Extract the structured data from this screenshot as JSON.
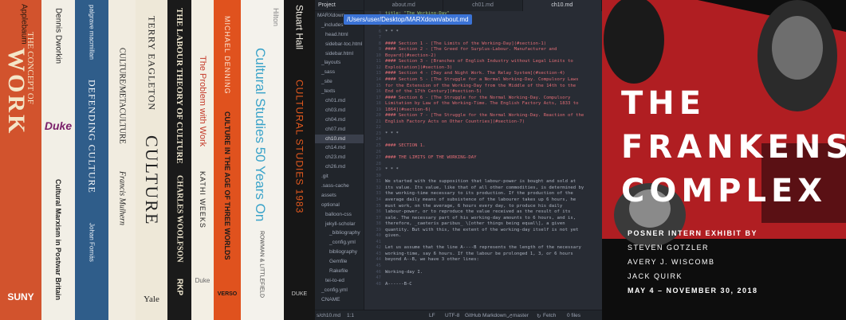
{
  "shelf": {
    "books": [
      {
        "title": "THE CONCEPT OF",
        "big": "WORK",
        "author": "Applebaum",
        "publisher": "SUNY"
      },
      {
        "author": "Dennis Dworkin",
        "publisher": "Duke",
        "title": "Cultural Marxism in Postwar Britain"
      },
      {
        "publisher": "palgrave macmillan",
        "title": "DEFENDING CULTURE",
        "author": "Johan Fornäs"
      },
      {
        "title": "CULTURE/METACULTURE",
        "author": "Francis Mulhern"
      },
      {
        "author": "TERRY EAGLETON",
        "title": "CULTURE",
        "publisher": "Yale"
      },
      {
        "title": "THE LABOUR THEORY OF CULTURE",
        "author": "CHARLES WOOLFSON",
        "publisher": "RKP"
      },
      {
        "title": "The Problem with Work",
        "author": "KATHI WEEKS",
        "publisher": "Duke"
      },
      {
        "author": "MICHAEL DENNING",
        "title": "CULTURE IN THE AGE OF THREE WORLDS",
        "publisher": "VERSO"
      },
      {
        "author": "Hilton",
        "title": "Cultural Studies 50 Years On",
        "publisher": "ROWMAN & LITTLEFIELD"
      },
      {
        "author": "Stuart Hall",
        "title": "CULTURAL STUDIES 1983",
        "publisher": "DUKE"
      }
    ]
  },
  "editor": {
    "tree_header": "Project",
    "path_tooltip": "/Users/user/Desktop/MARXdown/about.md",
    "tree": [
      "MARXdown",
      "_includes",
      "head.html",
      "sidebar-toc.html",
      "sidebar.html",
      "_layouts",
      "_sass",
      "_site",
      "_texts",
      "ch01.md",
      "ch03.md",
      "ch04.md",
      "ch07.md",
      "ch10.md",
      "ch14.md",
      "ch23.md",
      "ch26.md",
      ".git",
      ".sass-cache",
      "assets",
      "optional",
      "balloon-css",
      "jekyll-scholar",
      "_bibliography",
      "_config.yml",
      "bibliography",
      "Gemfile",
      "Rakefile",
      "tei-to-ed",
      "_config.yml",
      "CNAME"
    ],
    "selected_file": "ch10.md",
    "tabs": [
      "about.md",
      "ch01.md",
      "ch10.md"
    ],
    "active_tab": "ch10.md",
    "code": [
      {
        "c": "c-str",
        "t": "title: \"The Working-Day\""
      },
      {
        "c": "c-text",
        "t": "author:"
      },
      {
        "c": "c-text",
        "t": ""
      },
      {
        "c": "c-text",
        "t": "* * *"
      },
      {
        "c": "c-text",
        "t": ""
      },
      {
        "c": "c-head",
        "t": "#### Section 1 - [The Limits of the Working-Day](#section-1)"
      },
      {
        "c": "c-head",
        "t": "#### Section 2 - [The Greed for Surplus-Labour. Manufacturer and"
      },
      {
        "c": "c-head",
        "t": "Boyard](#section-2)"
      },
      {
        "c": "c-head",
        "t": "#### Section 3 - [Branches of English Industry without Legal Limits to"
      },
      {
        "c": "c-head",
        "t": "Exploitation](#section-3)"
      },
      {
        "c": "c-head",
        "t": "#### Section 4 - [Day and Night Work. The Relay System](#section-4)"
      },
      {
        "c": "c-head",
        "t": "#### Section 5 - [The Struggle for a Normal Working-Day. Compulsory Laws"
      },
      {
        "c": "c-head",
        "t": "for the Extension of the Working-Day from the Middle of the 14th to the"
      },
      {
        "c": "c-head",
        "t": "End of the 17th Century](#section-5)"
      },
      {
        "c": "c-head",
        "t": "#### Section 6 - [The Struggle for the Normal Working-Day. Compulsory"
      },
      {
        "c": "c-head",
        "t": "Limitation by Law of the Working-Time. The English Factory Acts, 1833 to"
      },
      {
        "c": "c-head",
        "t": "1864](#section-6)"
      },
      {
        "c": "c-head",
        "t": "#### Section 7 - [The Struggle for the Normal Working-Day. Reaction of the"
      },
      {
        "c": "c-head",
        "t": "English Factory Acts on Other Countries](#section-7)"
      },
      {
        "c": "c-text",
        "t": ""
      },
      {
        "c": "c-text",
        "t": "* * *"
      },
      {
        "c": "c-text",
        "t": ""
      },
      {
        "c": "c-head",
        "t": "#### SECTION 1."
      },
      {
        "c": "c-text",
        "t": ""
      },
      {
        "c": "c-head",
        "t": "#### THE LIMITS OF THE WORKING-DAY"
      },
      {
        "c": "c-text",
        "t": ""
      },
      {
        "c": "c-text",
        "t": "* * *"
      },
      {
        "c": "c-text",
        "t": ""
      },
      {
        "c": "c-text",
        "t": "We started with the supposition that labour-power is bought and sold at"
      },
      {
        "c": "c-text",
        "t": "its value. Its value, like that of all other commodities, is determined by"
      },
      {
        "c": "c-text",
        "t": "the working-time necessary to its production. If the production of the"
      },
      {
        "c": "c-text",
        "t": "average daily means of subsistence of the labourer takes up 6 hours, he"
      },
      {
        "c": "c-text",
        "t": "must work, on the average, 6 hours every day, to produce his daily"
      },
      {
        "c": "c-text",
        "t": "labour-power, or to reproduce the value received as the result of its"
      },
      {
        "c": "c-text",
        "t": "sale. The necessary part of his working-day amounts to 6 hours, and is,"
      },
      {
        "c": "c-text",
        "t": "therefore, _caeteris paribus_ \\[other things being equal\\], a given"
      },
      {
        "c": "c-text",
        "t": "quantity. But with this, the extent of the working-day itself is not yet"
      },
      {
        "c": "c-text",
        "t": "given."
      },
      {
        "c": "c-text",
        "t": ""
      },
      {
        "c": "c-text",
        "t": "Let us assume that the line A----B represents the length of the necessary"
      },
      {
        "c": "c-text",
        "t": "working-time, say 6 hours. If the labour be prolonged 1, 3, or 6 hours"
      },
      {
        "c": "c-text",
        "t": "beyond A--B, we have 3 other lines:"
      },
      {
        "c": "c-text",
        "t": ""
      },
      {
        "c": "c-text",
        "t": "Working-day I."
      },
      {
        "c": "c-text",
        "t": ""
      },
      {
        "c": "c-text",
        "t": "A------B-C"
      }
    ],
    "status": {
      "file": "s/ch10.md",
      "pos": "1:1",
      "eol": "LF",
      "encoding": "UTF-8",
      "grammar": "GitHub Markdown",
      "branch": "master",
      "fetch": "Fetch",
      "files": "0 files"
    }
  },
  "poster": {
    "title_lines": [
      "THE",
      "FRANKENSTE",
      "COMPLEX"
    ],
    "exhibit": "POSNER INTERN EXHIBIT BY",
    "names": [
      "STEVEN GOTZLER",
      "AVERY J. WISCOMB",
      "JACK QUIRK"
    ],
    "dates": "MAY 4 – NOVEMBER 30, 2018"
  }
}
